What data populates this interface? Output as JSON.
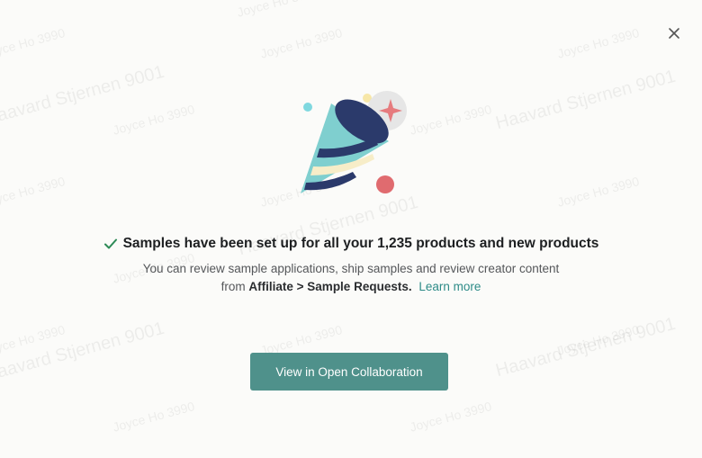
{
  "watermarks": {
    "names": [
      "Joyce Ho 3990",
      "Haavard Stjernen 9001"
    ]
  },
  "modal": {
    "close_icon": "close-icon",
    "illustration_icon": "party-popper-icon",
    "headline": "Samples have been set up for all your 1,235 products and new products",
    "description_line1": "You can review sample applications, ship samples and review creator content",
    "description_from": "from",
    "description_affiliate": "Affiliate",
    "description_separator": ">",
    "description_sample_requests": "Sample Requests.",
    "learn_more": "Learn more",
    "cta_label": "View in Open Collaboration"
  },
  "colors": {
    "accent": "#4f918b",
    "link": "#2d8b87",
    "check": "#2e8b57"
  }
}
